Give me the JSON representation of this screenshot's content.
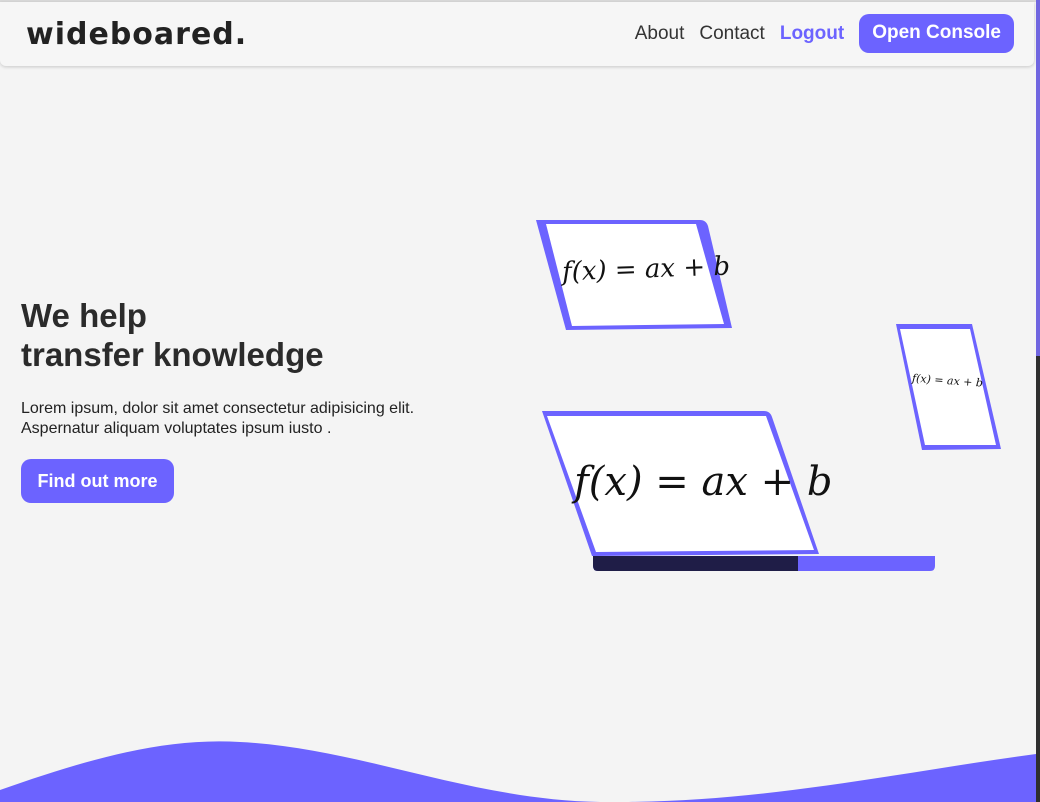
{
  "brand": {
    "logo": "wideboared."
  },
  "nav": {
    "about": "About",
    "contact": "Contact",
    "logout": "Logout",
    "console": "Open Console"
  },
  "hero": {
    "title_line1": "We help",
    "title_line2": "transfer knowledge",
    "description_line1": "Lorem ipsum, dolor sit amet consectetur adipisicing elit.",
    "description_line2": "Aspernatur aliquam voluptates ipsum iusto .",
    "cta": "Find out more"
  },
  "illustration": {
    "formula": "f(x) = ax + b"
  },
  "colors": {
    "accent": "#6c63ff",
    "dark": "#1f1d47",
    "background": "#f4f4f4"
  }
}
